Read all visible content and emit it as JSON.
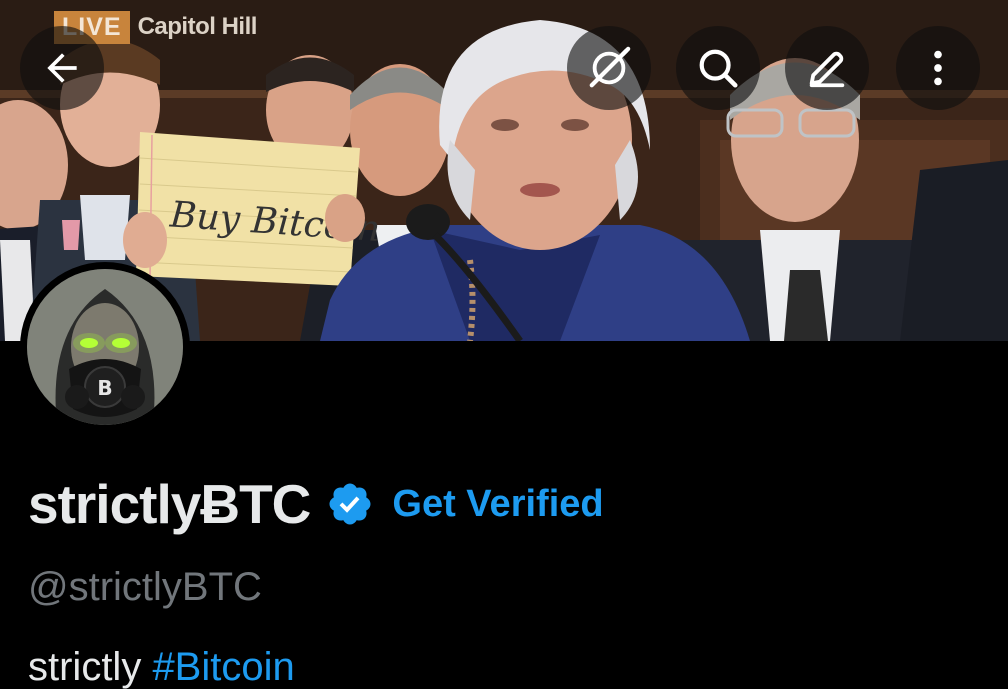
{
  "banner": {
    "live_label": "LIVE",
    "location_label": "Capitol Hill",
    "sign_text": "Buy Bitcoin"
  },
  "header": {
    "icons": [
      "back-arrow-icon",
      "grok-icon",
      "search-icon",
      "edit-icon",
      "more-vertical-icon"
    ]
  },
  "avatar": {
    "badge_letter": "B"
  },
  "profile": {
    "display_name": "strictlyɃTC",
    "verified": true,
    "get_verified_label": "Get Verified",
    "handle": "@strictlyBTC",
    "bio_text": "strictly ",
    "bio_hashtag": "#Bitcoin"
  },
  "colors": {
    "accent": "#1d9bf0",
    "background": "#000000",
    "secondary_text": "#71767b",
    "primary_text": "#e7e9ea"
  }
}
